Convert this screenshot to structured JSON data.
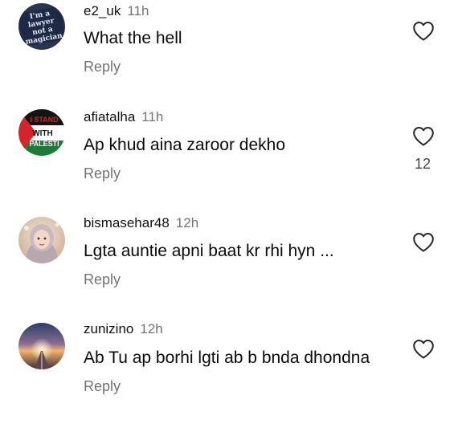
{
  "comments": [
    {
      "username": "e2_uk",
      "time": "11h",
      "text": "What the hell",
      "reply_label": "Reply",
      "like_count": "",
      "avatar_text": [
        "I'm a",
        "lawyer",
        "not a",
        "magician"
      ]
    },
    {
      "username": "afiatalha",
      "time": "11h",
      "text": "Ap khud aina zaroor dekho",
      "reply_label": "Reply",
      "like_count": "12",
      "avatar_text": [
        "I STAND",
        "WITH",
        "PALESTI"
      ]
    },
    {
      "username": "bismasehar48",
      "time": "12h",
      "text": "Lgta auntie apni baat kr rhi hyn ...",
      "reply_label": "Reply",
      "like_count": ""
    },
    {
      "username": "zunizino",
      "time": "12h",
      "text": "Ab Tu ap borhi lgti ab b bnda dhondna",
      "reply_label": "Reply",
      "like_count": ""
    }
  ],
  "colors": {
    "muted_text": "#737373",
    "palestine_red": "#d3252b",
    "palestine_green": "#1f7a38"
  }
}
